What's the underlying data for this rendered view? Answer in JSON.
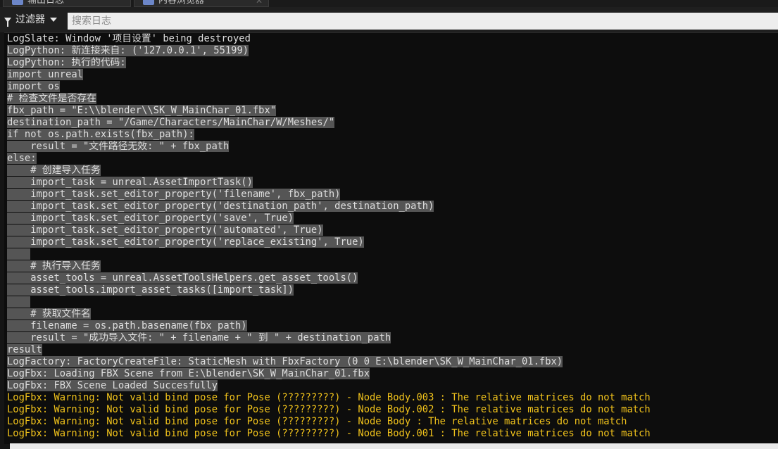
{
  "tabs": [
    {
      "label": "输出日志"
    },
    {
      "label": "内容浏览器"
    }
  ],
  "toolbar": {
    "filter_label": "过滤器",
    "search_placeholder": "搜索日志"
  },
  "log": [
    {
      "text": "LogSlate: Window '项目设置' being destroyed",
      "selected": false,
      "level": "normal"
    },
    {
      "text": "LogPython: 新连接来自: ('127.0.0.1', 55199)",
      "selected": true,
      "level": "normal"
    },
    {
      "text": "LogPython: 执行的代码:",
      "selected": true,
      "level": "normal"
    },
    {
      "text": "import unreal",
      "selected": true,
      "level": "normal"
    },
    {
      "text": "import os",
      "selected": true,
      "level": "normal"
    },
    {
      "text": "# 检查文件是否存在",
      "selected": true,
      "level": "normal"
    },
    {
      "text": "fbx_path = \"E:\\\\blender\\\\SK_W_MainChar_01.fbx\"",
      "selected": true,
      "level": "normal"
    },
    {
      "text": "destination_path = \"/Game/Characters/MainChar/W/Meshes/\"",
      "selected": true,
      "level": "normal"
    },
    {
      "text": "if not os.path.exists(fbx_path):",
      "selected": true,
      "level": "normal"
    },
    {
      "text": "    result = \"文件路径无效: \" + fbx_path",
      "selected": true,
      "level": "normal"
    },
    {
      "text": "else:",
      "selected": true,
      "level": "normal"
    },
    {
      "text": "    # 创建导入任务",
      "selected": true,
      "level": "normal"
    },
    {
      "text": "    import_task = unreal.AssetImportTask()",
      "selected": true,
      "level": "normal"
    },
    {
      "text": "    import_task.set_editor_property('filename', fbx_path)",
      "selected": true,
      "level": "normal"
    },
    {
      "text": "    import_task.set_editor_property('destination_path', destination_path)",
      "selected": true,
      "level": "normal"
    },
    {
      "text": "    import_task.set_editor_property('save', True)",
      "selected": true,
      "level": "normal"
    },
    {
      "text": "    import_task.set_editor_property('automated', True)",
      "selected": true,
      "level": "normal"
    },
    {
      "text": "    import_task.set_editor_property('replace_existing', True)",
      "selected": true,
      "level": "normal"
    },
    {
      "text": "    ",
      "selected": true,
      "level": "normal"
    },
    {
      "text": "    # 执行导入任务",
      "selected": true,
      "level": "normal"
    },
    {
      "text": "    asset_tools = unreal.AssetToolsHelpers.get_asset_tools()",
      "selected": true,
      "level": "normal"
    },
    {
      "text": "    asset_tools.import_asset_tasks([import_task])",
      "selected": true,
      "level": "normal"
    },
    {
      "text": "    ",
      "selected": true,
      "level": "normal"
    },
    {
      "text": "    # 获取文件名",
      "selected": true,
      "level": "normal"
    },
    {
      "text": "    filename = os.path.basename(fbx_path)",
      "selected": true,
      "level": "normal"
    },
    {
      "text": "    result = \"成功导入文件: \" + filename + \" 到 \" + destination_path",
      "selected": true,
      "level": "normal"
    },
    {
      "text": "result",
      "selected": true,
      "level": "normal"
    },
    {
      "text": "LogFactory: FactoryCreateFile: StaticMesh with FbxFactory (0 0 E:\\blender\\SK_W_MainChar_01.fbx)",
      "selected": true,
      "level": "normal"
    },
    {
      "text": "LogFbx: Loading FBX Scene from E:\\blender\\SK_W_MainChar_01.fbx",
      "selected": true,
      "level": "normal"
    },
    {
      "text": "LogFbx: FBX Scene Loaded Succesfully",
      "selected": true,
      "level": "normal"
    },
    {
      "text": "LogFbx: Warning: Not valid bind pose for Pose (?????????) - Node Body.003 : The relative matrices do not match",
      "selected": false,
      "level": "warning"
    },
    {
      "text": "LogFbx: Warning: Not valid bind pose for Pose (?????????) - Node Body.002 : The relative matrices do not match",
      "selected": false,
      "level": "warning"
    },
    {
      "text": "LogFbx: Warning: Not valid bind pose for Pose (?????????) - Node Body : The relative matrices do not match",
      "selected": false,
      "level": "warning"
    },
    {
      "text": "LogFbx: Warning: Not valid bind pose for Pose (?????????) - Node Body.001 : The relative matrices do not match",
      "selected": false,
      "level": "warning"
    }
  ],
  "colors": {
    "warning": "#f0c21b",
    "selection": "#555555",
    "text": "#dedede"
  }
}
